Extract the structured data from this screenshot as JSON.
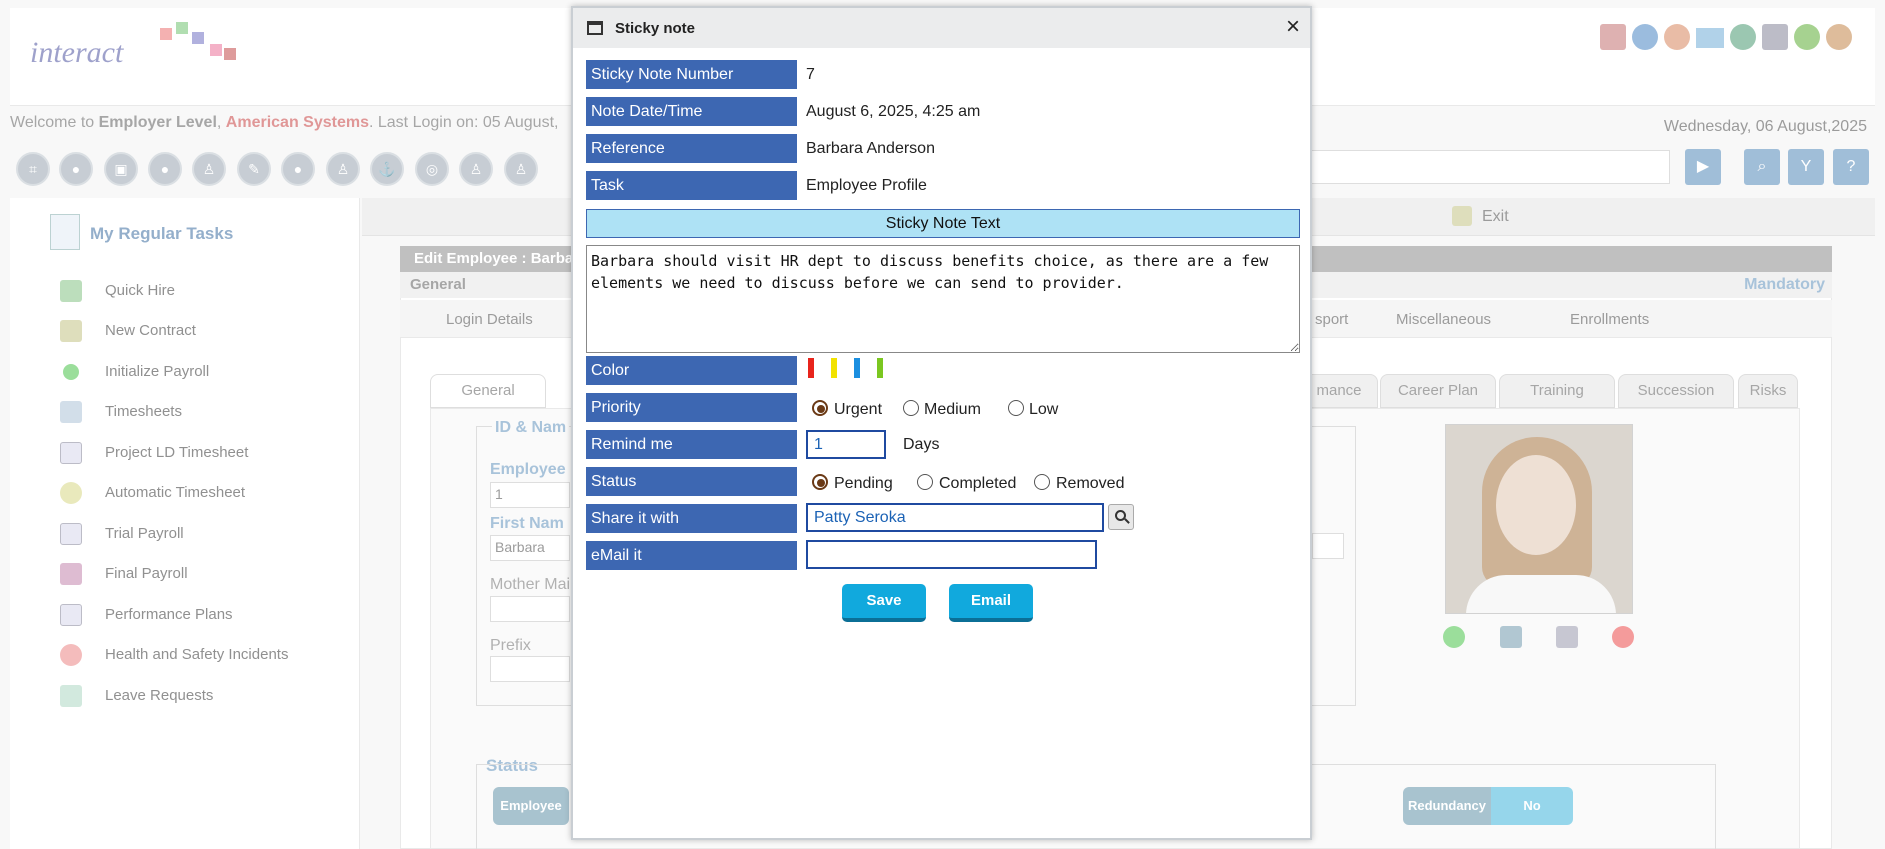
{
  "app": {
    "logo": "interact",
    "welcome_prefix": "Welcome to ",
    "employer_level": "Employer Level",
    "company": "American Systems",
    "last_login": ". Last Login on: 05 August,",
    "date": "Wednesday, 06 August,2025"
  },
  "sidebar": {
    "title": "My Regular Tasks",
    "items": [
      {
        "label": "Quick Hire"
      },
      {
        "label": "New Contract"
      },
      {
        "label": "Initialize Payroll"
      },
      {
        "label": "Timesheets"
      },
      {
        "label": "Project LD Timesheet"
      },
      {
        "label": "Automatic Timesheet"
      },
      {
        "label": "Trial Payroll"
      },
      {
        "label": "Final Payroll"
      },
      {
        "label": "Performance Plans"
      },
      {
        "label": "Health and Safety Incidents"
      },
      {
        "label": "Leave Requests"
      }
    ]
  },
  "toolbar": {
    "exit_label": "Exit"
  },
  "edit_panel": {
    "title": "Edit Employee : Barba",
    "section": "General",
    "mandatory": "Mandatory",
    "subtabs": [
      "Login Details",
      "sport",
      "Miscellaneous",
      "Enrollments"
    ],
    "tabs": [
      "General",
      "mance",
      "Career Plan",
      "Training",
      "Succession",
      "Risks"
    ],
    "id_name_title": "ID & Nam",
    "employee_label": "Employee",
    "employee_value": "1",
    "first_name_label": "First Nam",
    "first_name_value": "Barbara",
    "mother_label": "Mother Mai",
    "prefix_label": "Prefix",
    "status_title": "Status",
    "status_employee": "Employee",
    "redundancy_label": "Redundancy",
    "redundancy_value": "No"
  },
  "dialog": {
    "title": "Sticky note",
    "close": "×",
    "fields": {
      "number_label": "Sticky Note Number",
      "number_value": "7",
      "datetime_label": "Note Date/Time",
      "datetime_value": "August 6, 2025, 4:25 am",
      "reference_label": "Reference",
      "reference_value": "Barbara Anderson",
      "task_label": "Task",
      "task_value": "Employee Profile",
      "text_header": "Sticky Note Text",
      "note_text": "Barbara should visit HR dept to discuss benefits choice, as there are a few elements we need to discuss before we can send to provider.",
      "color_label": "Color",
      "colors": [
        "#e8241c",
        "#f2e200",
        "#1b8fe0",
        "#7bc720"
      ],
      "priority_label": "Priority",
      "priority_options": [
        "Urgent",
        "Medium",
        "Low"
      ],
      "priority_selected": "Urgent",
      "remind_label": "Remind me",
      "remind_value": "1",
      "remind_unit": "Days",
      "status_label": "Status",
      "status_options": [
        "Pending",
        "Completed",
        "Removed"
      ],
      "status_selected": "Pending",
      "share_label": "Share it with",
      "share_value": "Patty Seroka",
      "email_label": "eMail it",
      "email_value": ""
    },
    "buttons": {
      "save": "Save",
      "email": "Email"
    }
  }
}
